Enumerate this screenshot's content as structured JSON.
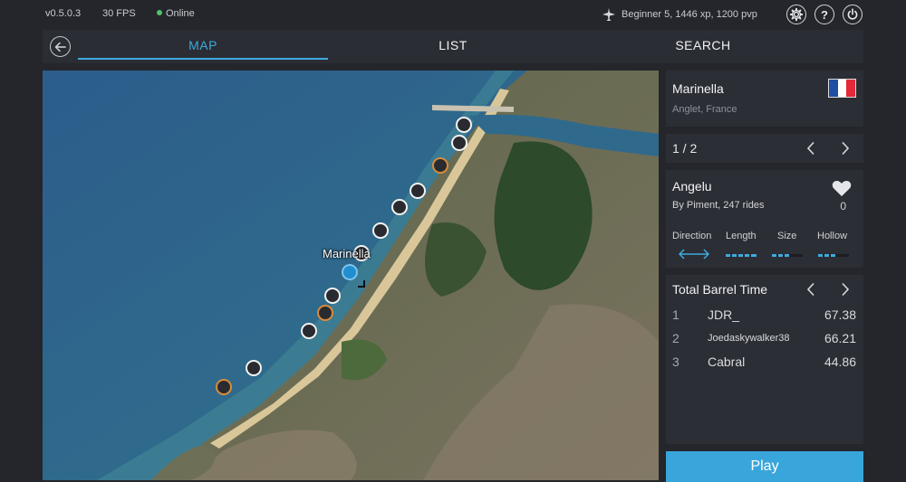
{
  "status": {
    "version": "v0.5.0.3",
    "fps": "30 FPS",
    "connection": "Online",
    "player_info": "Beginner 5, 1446 xp, 1200 pvp"
  },
  "nav": {
    "tabs": [
      {
        "label": "MAP",
        "active": true
      },
      {
        "label": "LIST",
        "active": false
      },
      {
        "label": "SEARCH",
        "active": false
      }
    ]
  },
  "map": {
    "selected_label": "Marinella"
  },
  "spot_header": {
    "name": "Marinella",
    "location": "Anglet, France",
    "flag_colors": [
      "#1f4ea3",
      "#ffffff",
      "#e4293a"
    ]
  },
  "pager": {
    "text": "1 / 2"
  },
  "wave": {
    "name": "Angelu",
    "author": "By Piment, 247 rides",
    "likes": "0",
    "attributes": [
      {
        "label": "Direction"
      },
      {
        "label": "Length"
      },
      {
        "label": "Size"
      },
      {
        "label": "Hollow"
      }
    ]
  },
  "leaderboard": {
    "title": "Total Barrel Time",
    "rows": [
      {
        "rank": "1",
        "name": "JDR_",
        "time": "67.38"
      },
      {
        "rank": "2",
        "name": "Joedaskywalker38",
        "time": "66.21"
      },
      {
        "rank": "3",
        "name": "Cabral",
        "time": "44.86"
      }
    ]
  },
  "play_label": "Play",
  "colors": {
    "accent": "#3fa9df",
    "spot_marker": "#2a2b30",
    "spot_marker_alt": "#d98b3a"
  }
}
